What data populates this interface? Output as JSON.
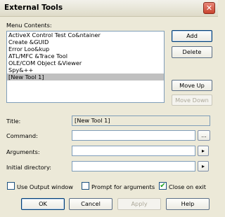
{
  "window": {
    "title": "External Tools",
    "close_glyph": "✕"
  },
  "menu_contents": {
    "label": "Menu Contents:",
    "items": [
      "ActiveX Control Test Co&ntainer",
      "Create &GUID",
      "Error Loo&kup",
      "ATL/MFC &Trace Tool",
      "OLE/COM Object &Viewer",
      "Spy&++",
      "[New Tool 1]"
    ],
    "selected_index": 6
  },
  "side_buttons": {
    "add": "Add",
    "delete": "Delete",
    "move_up": "Move Up",
    "move_down": "Move Down"
  },
  "fields": {
    "title_label": "Title:",
    "title_value": "[New Tool 1]",
    "command_label": "Command:",
    "command_value": "",
    "command_browse": "...",
    "arguments_label": "Arguments:",
    "arguments_value": "",
    "arguments_arrow": "▸",
    "initial_dir_label": "Initial directory:",
    "initial_dir_value": "",
    "initial_dir_arrow": "▸"
  },
  "options": {
    "use_output_window": {
      "label": "Use Output window",
      "checked": false
    },
    "prompt_for_arguments": {
      "label": "Prompt for arguments",
      "checked": false
    },
    "close_on_exit": {
      "label": "Close on exit",
      "checked": true
    },
    "check_glyph": "✔"
  },
  "footer": {
    "ok": "OK",
    "cancel": "Cancel",
    "apply": "Apply",
    "help": "Help"
  }
}
